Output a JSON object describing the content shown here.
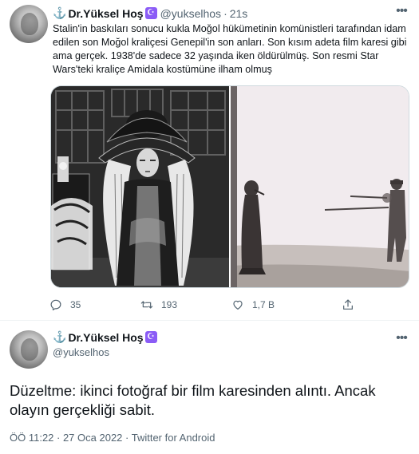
{
  "tweet": {
    "author_name": "Dr.Yüksel Hoş",
    "handle": "@yukselhos",
    "separator": "·",
    "time": "21s",
    "text": "Stalin'in baskıları sonucu kukla Moğol hükümetinin komünistleri tarafından idam edilen son Moğol kraliçesi Genepil'in son anları. Son kısım adeta film karesi gibi ama gerçek. 1938'de sadece 32 yaşında iken öldürülmüş. Son resmi Star Wars'teki kraliçe Amidala kostümüne ilham olmuş",
    "replies": "35",
    "retweets": "193",
    "likes": "1,7 B"
  },
  "reply": {
    "author_name": "Dr.Yüksel Hoş",
    "handle": "@yukselhos",
    "text": "Düzeltme: ikinci fotoğraf bir film karesinden alıntı. Ancak olayın gerçekliği sabit.",
    "meta": "ÖÖ 11:22 · 27 Oca 2022 · Twitter for Android"
  },
  "icons": {
    "anchor": "anchor-icon",
    "badge": "crescent-star-icon",
    "more": "more-icon",
    "reply": "reply-icon",
    "retweet": "retweet-icon",
    "like": "heart-icon",
    "share": "share-icon"
  },
  "colors": {
    "accent": "#1d9bf0",
    "secondary_text": "#536471",
    "badge": "#8b5cf6",
    "divider": "#eff3f4"
  }
}
